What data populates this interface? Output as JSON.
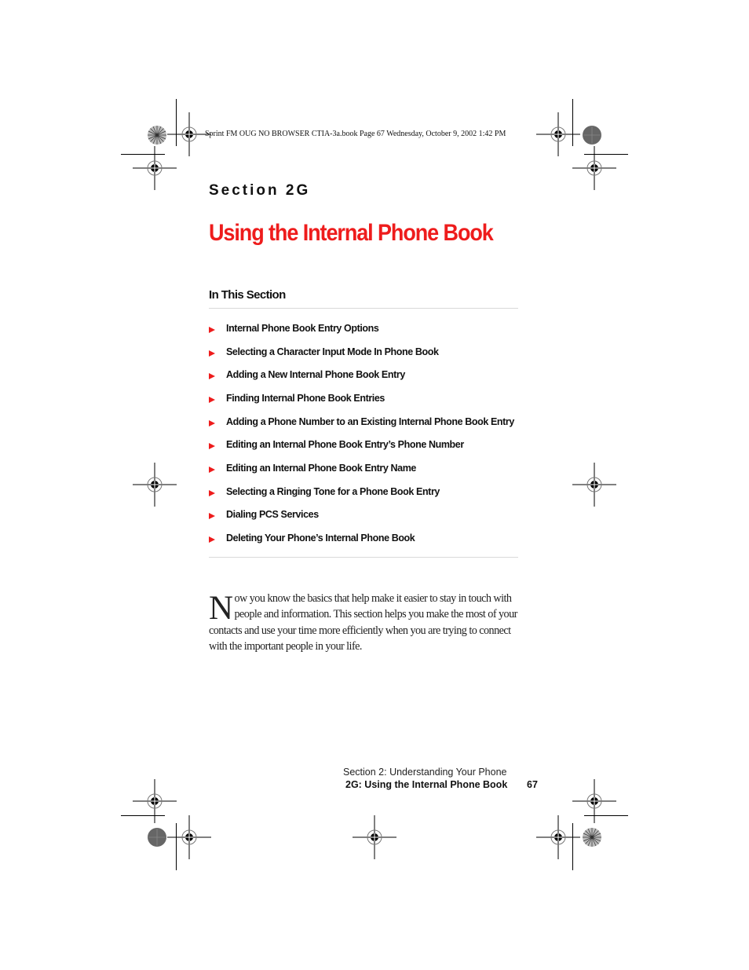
{
  "print_header": "Sprint FM OUG NO BROWSER CTIA-3a.book  Page 67  Wednesday, October 9, 2002  1:42 PM",
  "section_label": "Section 2G",
  "title": "Using the Internal Phone Book",
  "in_this_section": {
    "heading": "In This Section",
    "items": [
      "Internal Phone Book Entry Options",
      "Selecting a Character Input Mode In Phone Book",
      "Adding a New Internal Phone Book Entry",
      "Finding Internal Phone Book Entries",
      "Adding a Phone Number to an Existing Internal Phone Book Entry",
      "Editing an Internal Phone Book Entry’s Phone Number",
      "Editing an Internal Phone Book Entry Name",
      "Selecting a Ringing Tone for a Phone Book Entry",
      "Dialing PCS Services",
      "Deleting Your Phone’s Internal Phone Book"
    ]
  },
  "intro": {
    "drop_cap": "N",
    "text": "ow you know the basics that help make it easier to stay in touch with people and information. This section helps you make the most of your contacts and use your time more efficiently when you are trying to connect with the important people in your life."
  },
  "footer": {
    "chapter": "Section 2: Understanding Your Phone",
    "section": "2G: Using the Internal Phone Book",
    "page_number": "67"
  },
  "colors": {
    "accent": "#ee1c1c",
    "text": "#111111"
  }
}
